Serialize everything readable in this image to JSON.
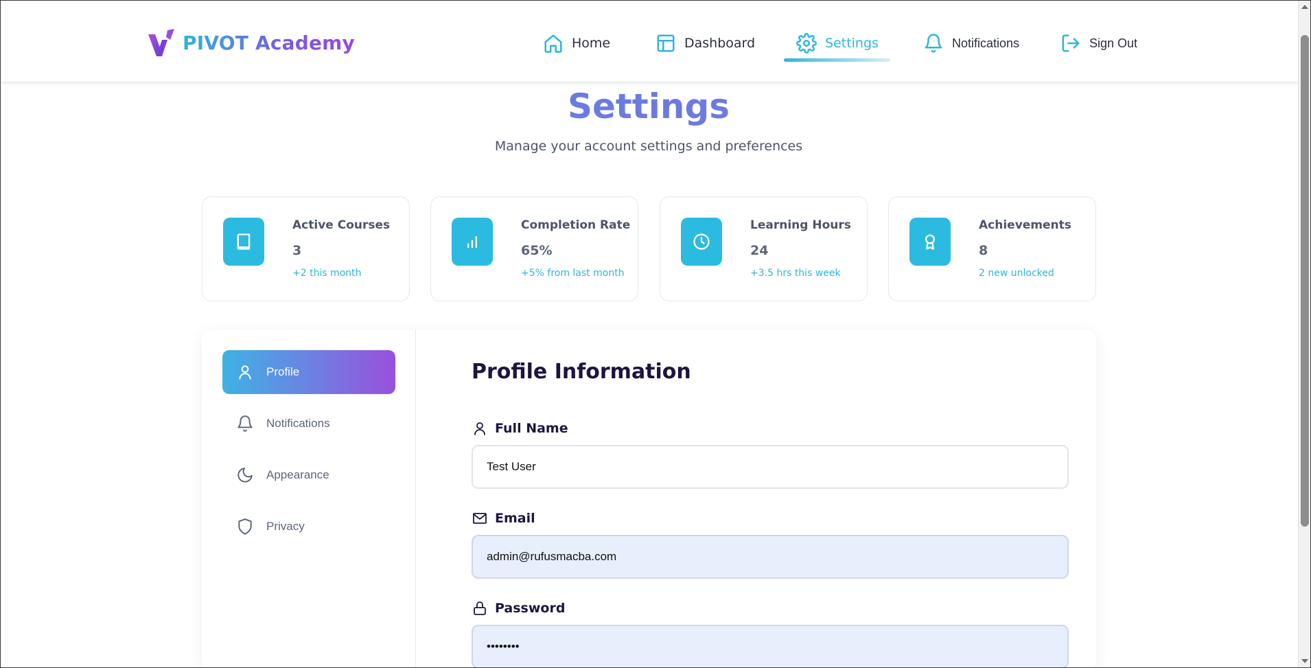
{
  "brand": {
    "name": "PIVOT Academy"
  },
  "nav": {
    "items": [
      {
        "label": "Home",
        "icon": "home-icon"
      },
      {
        "label": "Dashboard",
        "icon": "dashboard-icon"
      },
      {
        "label": "Settings",
        "icon": "gear-icon",
        "active": true
      },
      {
        "label": "Notifications",
        "icon": "bell-icon"
      },
      {
        "label": "Sign Out",
        "icon": "sign-out-icon"
      }
    ]
  },
  "header": {
    "title": "Settings",
    "subtitle": "Manage your account settings and preferences"
  },
  "stats": [
    {
      "label": "Active Courses",
      "value": "3",
      "note": "+2 this month",
      "icon": "book-icon"
    },
    {
      "label": "Completion Rate",
      "value": "65%",
      "note": "+5% from last month",
      "icon": "bar-chart-icon"
    },
    {
      "label": "Learning Hours",
      "value": "24",
      "note": "+3.5 hrs this week",
      "icon": "clock-icon"
    },
    {
      "label": "Achievements",
      "value": "8",
      "note": "2 new unlocked",
      "icon": "award-icon"
    }
  ],
  "sidebar": {
    "items": [
      {
        "label": "Profile",
        "icon": "user-icon",
        "active": true
      },
      {
        "label": "Notifications",
        "icon": "bell-icon"
      },
      {
        "label": "Appearance",
        "icon": "moon-icon"
      },
      {
        "label": "Privacy",
        "icon": "shield-icon"
      }
    ]
  },
  "profile": {
    "title": "Profile Information",
    "full_name_label": "Full Name",
    "full_name_value": "Test User",
    "email_label": "Email",
    "email_value": "admin@rufusmacba.com",
    "password_label": "Password",
    "password_value": "••••••••"
  },
  "colors": {
    "accent": "#2fb5dd",
    "gradient_start": "#3fb2e4",
    "gradient_end": "#9a4fdc",
    "heading": "#1f1440"
  }
}
